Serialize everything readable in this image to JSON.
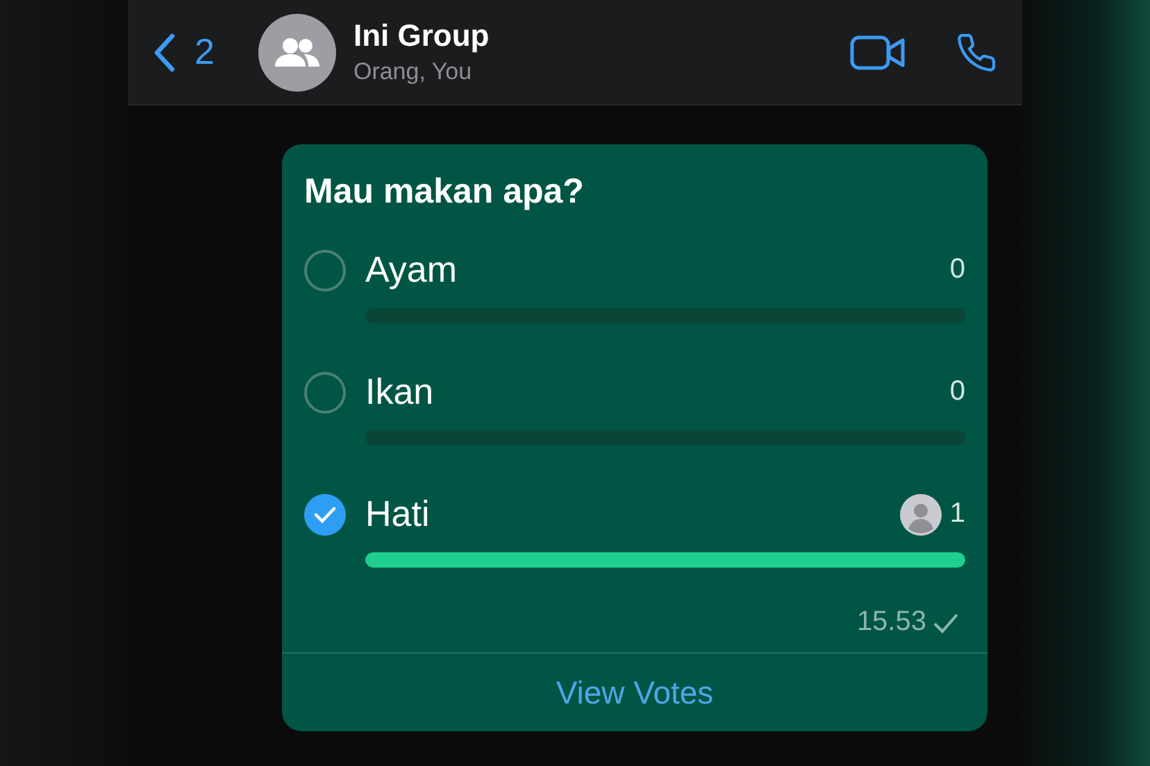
{
  "header": {
    "back_count": "2",
    "title": "Ini Group",
    "subtitle": "Orang, You"
  },
  "poll": {
    "question": "Mau makan apa?",
    "options": [
      {
        "label": "Ayam",
        "count": "0",
        "selected": false,
        "level": 0,
        "has_voter": false
      },
      {
        "label": "Ikan",
        "count": "0",
        "selected": false,
        "level": 0,
        "has_voter": false
      },
      {
        "label": "Hati",
        "count": "1",
        "selected": true,
        "level": 1,
        "has_voter": true
      }
    ],
    "time": "15.53",
    "footer_action": "View Votes"
  }
}
